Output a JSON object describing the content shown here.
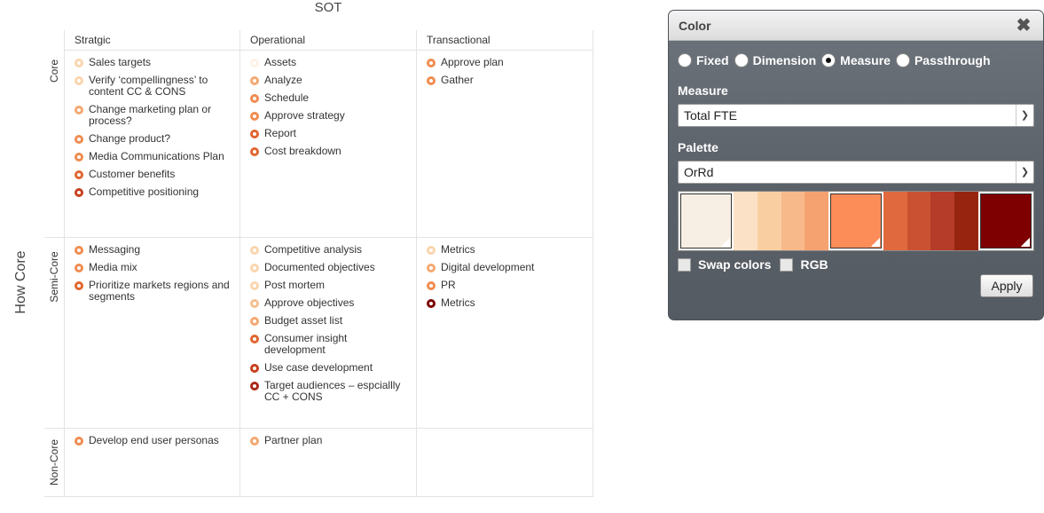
{
  "matrix": {
    "title": "SOT",
    "y_axis_label": "How Core",
    "columns": [
      "Stratgic",
      "Operational",
      "Transactional"
    ],
    "rows": [
      {
        "label": "Core",
        "cells": [
          [
            {
              "text": "Sales targets",
              "color": "#fad5ad"
            },
            {
              "text": "Verify ‘compellingness’ to content CC & CONS",
              "color": "#fad5ad"
            },
            {
              "text": "Change marketing plan or process?",
              "color": "#f5a871"
            },
            {
              "text": "Change product?",
              "color": "#f08c50"
            },
            {
              "text": "Media Communications Plan",
              "color": "#f08c50"
            },
            {
              "text": "Customer benefits",
              "color": "#e0662f"
            },
            {
              "text": "Competitive positioning",
              "color": "#c8401e"
            }
          ],
          [
            {
              "text": "Assets",
              "color": "#fdf2e6"
            },
            {
              "text": "Analyze",
              "color": "#f5a871"
            },
            {
              "text": "Schedule",
              "color": "#f08c50"
            },
            {
              "text": "Approve strategy",
              "color": "#f08c50"
            },
            {
              "text": "Report",
              "color": "#e0662f"
            },
            {
              "text": "Cost breakdown",
              "color": "#e0662f"
            }
          ],
          [
            {
              "text": "Approve plan",
              "color": "#f08c50"
            },
            {
              "text": "Gather",
              "color": "#f08c50"
            }
          ]
        ]
      },
      {
        "label": "Semi-Core",
        "cells": [
          [
            {
              "text": "Messaging",
              "color": "#f08c50"
            },
            {
              "text": "Media mix",
              "color": "#f08c50"
            },
            {
              "text": "Prioritize markets regions and segments",
              "color": "#e0662f"
            }
          ],
          [
            {
              "text": "Competitive analysis",
              "color": "#fad5ad"
            },
            {
              "text": "Documented objectives",
              "color": "#fad5ad"
            },
            {
              "text": "Post mortem",
              "color": "#fad5ad"
            },
            {
              "text": "Approve objectives",
              "color": "#f5c090"
            },
            {
              "text": "Budget asset list",
              "color": "#f5a871"
            },
            {
              "text": "Consumer insight development",
              "color": "#e0662f"
            },
            {
              "text": "Use case development",
              "color": "#c8401e"
            },
            {
              "text": "Target audiences – espciallly CC + CONS",
              "color": "#a82a18"
            }
          ],
          [
            {
              "text": "Metrics",
              "color": "#fad5ad"
            },
            {
              "text": "Digital development",
              "color": "#f5a871"
            },
            {
              "text": "PR",
              "color": "#f08c50"
            },
            {
              "text": "Metrics",
              "color": "#7a0000"
            }
          ]
        ]
      },
      {
        "label": "Non-Core",
        "cells": [
          [
            {
              "text": "Develop end user personas",
              "color": "#f08c50"
            }
          ],
          [
            {
              "text": "Partner plan",
              "color": "#f5a871"
            }
          ],
          []
        ]
      }
    ]
  },
  "panel": {
    "title": "Color",
    "radios": [
      {
        "label": "Fixed",
        "selected": false
      },
      {
        "label": "Dimension",
        "selected": false
      },
      {
        "label": "Measure",
        "selected": true
      },
      {
        "label": "Passthrough",
        "selected": false
      }
    ],
    "measure_label": "Measure",
    "measure_value": "Total FTE",
    "palette_label": "Palette",
    "palette_value": "OrRd",
    "swatches": [
      {
        "color": "#f8efe4",
        "big": true
      },
      {
        "color": "#fbe2c6",
        "big": false
      },
      {
        "color": "#f9cfa2",
        "big": false
      },
      {
        "color": "#f7b98a",
        "big": false
      },
      {
        "color": "#f5a270",
        "big": false
      },
      {
        "color": "#fc8d59",
        "big": true
      },
      {
        "color": "#e06a3e",
        "big": false
      },
      {
        "color": "#ca5232",
        "big": false
      },
      {
        "color": "#b43c28",
        "big": false
      },
      {
        "color": "#96240f",
        "big": false
      },
      {
        "color": "#7f0000",
        "big": true
      }
    ],
    "swap_label": "Swap colors",
    "rgb_label": "RGB",
    "apply_label": "Apply"
  }
}
